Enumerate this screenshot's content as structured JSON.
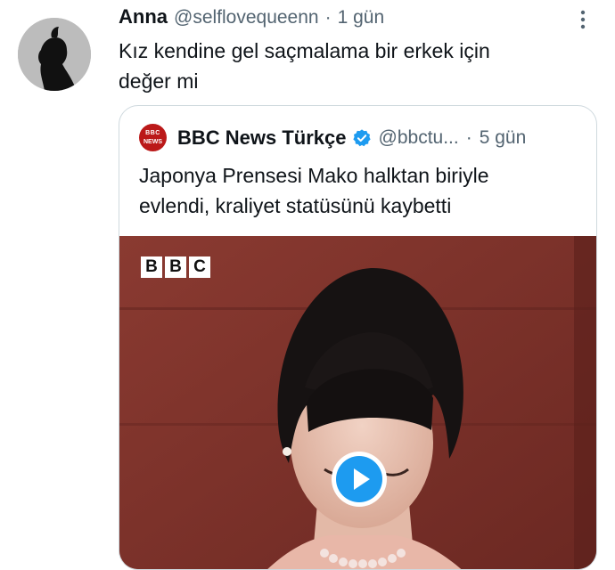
{
  "tweet": {
    "display_name": "Anna",
    "handle": "@selflovequeenn",
    "separator": "·",
    "time": "1 gün",
    "text_line1": "Kız kendine gel saçmalama bir erkek için",
    "text_line2": "değer mi",
    "avatar_icon": "silhouette-avatar",
    "more_icon": "vertical-dots-icon"
  },
  "quote": {
    "logo_top": "BBC",
    "logo_bottom": "NEWS",
    "display_name": "BBC News Türkçe",
    "verified_icon": "verified-badge-icon",
    "handle": "@bbctu...",
    "separator": "·",
    "time": "5 gün",
    "text_line1": "Japonya Prensesi Mako halktan biriyle",
    "text_line2": "evlendi, kraliyet statüsünü kaybetti",
    "media": {
      "watermark": [
        "B",
        "B",
        "C"
      ],
      "play_icon": "play-icon",
      "background_color": "#7d2f28"
    }
  },
  "colors": {
    "text": "#0f1419",
    "secondary": "#536471",
    "verified": "#1d9bf0",
    "border": "#cfd9de",
    "bbc_red": "#bb1919"
  }
}
